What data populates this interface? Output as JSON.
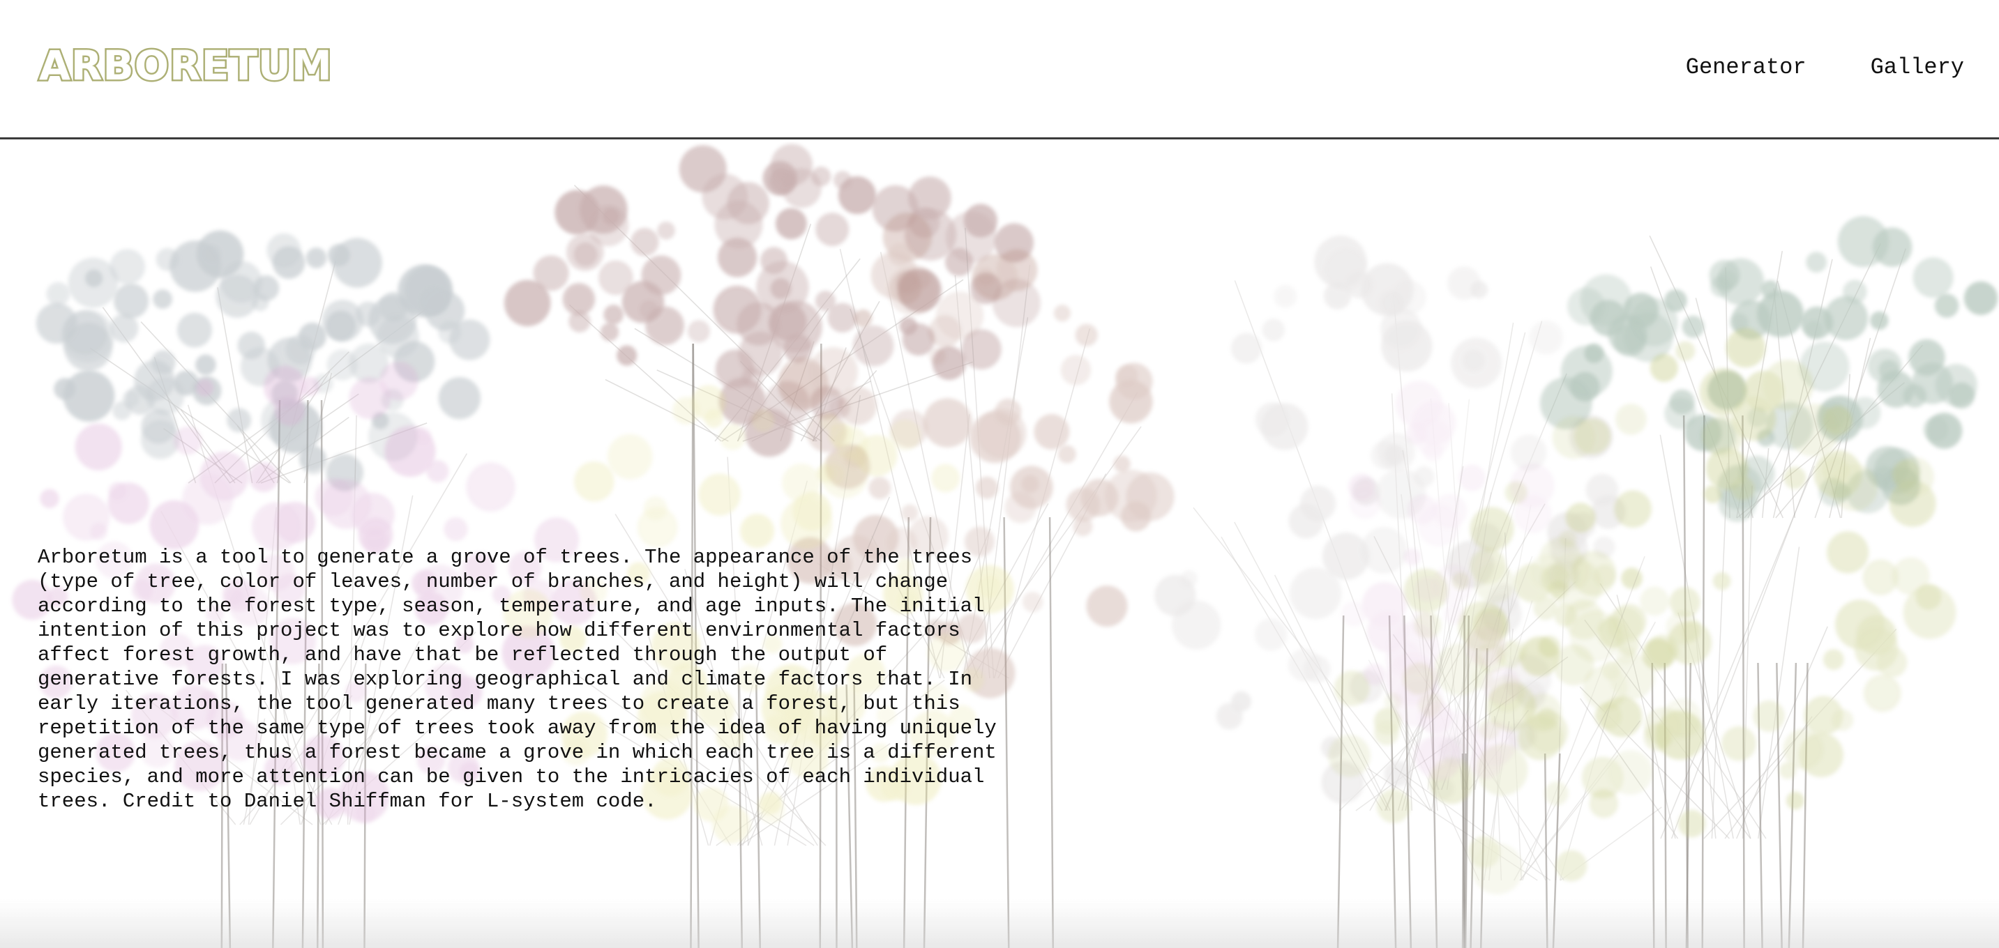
{
  "header": {
    "logo_text": "ARBORETUM",
    "nav": [
      {
        "label": "Generator"
      },
      {
        "label": "Gallery"
      }
    ]
  },
  "intro_lines": [
    "Arboretum is a tool to generate a grove of trees. The appearance of the trees",
    "(type of tree, color of leaves, number of branches, and height) will change",
    "according to the forest type, season, temperature, and age inputs. The initial",
    "intention of this project was to explore how different environmental factors",
    "affect forest growth, and have that be reflected through the output of",
    "generative forests. I was exploring geographical and climate factors that. In",
    "early iterations, the tool generated many trees to create a forest, but this",
    "repetition of the same type of trees took away from the idea of having uniquely",
    "generated trees, thus a forest became a grove in which each tree is a different",
    "species, and more attention can be given to the intricacies of each individual",
    "trees. Credit to Daniel Shiffman for L-system code."
  ],
  "colors": {
    "logo_outline": "#a8ab6f",
    "header_rule": "#3b3b3b",
    "tree_slate": "#9aa4ab",
    "tree_mauve": "#9c6f6f",
    "tree_pink": "#d9a9d3",
    "tree_yellow": "#e6e29a",
    "tree_brown": "#b58c80",
    "tree_grey": "#c9c4c4",
    "tree_sage": "#7f9e8c",
    "tree_olive": "#c3c97f",
    "trunk": "#8f8a85"
  }
}
